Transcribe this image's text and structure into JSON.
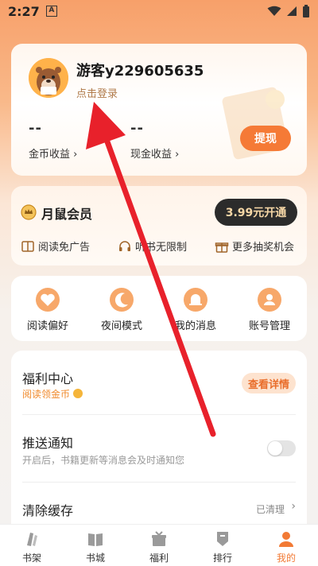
{
  "status_bar": {
    "time": "2:27",
    "badge": "A"
  },
  "profile": {
    "username": "游客y229605635",
    "login_link": "点击登录",
    "coins_value": "--",
    "coins_label": "金币收益",
    "cash_value": "--",
    "cash_label": "现金收益",
    "withdraw_label": "提现"
  },
  "membership": {
    "title": "月鼠会员",
    "open_button": "3.99元开通",
    "perks": [
      "阅读免广告",
      "听书无限制",
      "更多抽奖机会"
    ]
  },
  "quick_actions": [
    "阅读偏好",
    "夜间模式",
    "我的消息",
    "账号管理"
  ],
  "settings": {
    "welfare_title": "福利中心",
    "welfare_sub": "阅读领金币",
    "welfare_button": "查看详情",
    "push_title": "推送通知",
    "push_sub": "开启后，书籍更新等消息会及时通知您",
    "push_enabled": false,
    "cache_title": "清除缓存",
    "cache_status": "已清理",
    "chevron": "›"
  },
  "bottom_nav": {
    "items": [
      "书架",
      "书城",
      "福利",
      "排行",
      "我的"
    ],
    "active_index": 4
  },
  "colors": {
    "accent": "#f57a36",
    "annotation": "#e8212b"
  }
}
